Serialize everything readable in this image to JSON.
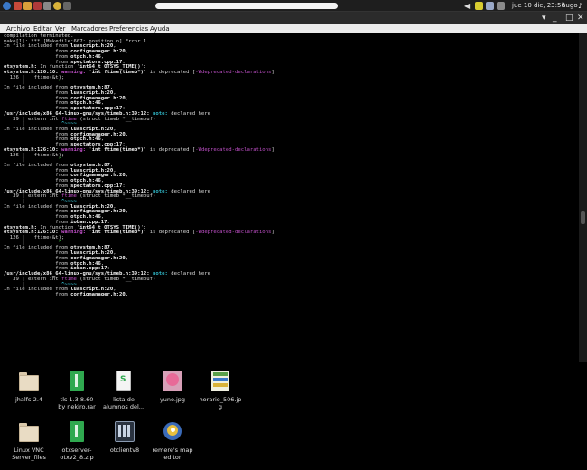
{
  "topbar": {
    "clock": "jue 10 dic, 23:56",
    "user": "hugo"
  },
  "window": {
    "controls": {
      "minimize": "_",
      "maximize": "□",
      "close": "✕",
      "menu": "▾"
    }
  },
  "menu": [
    "Archivo",
    "Editar",
    "Ver",
    "Marcadores",
    "Preferencias",
    "Ayuda"
  ],
  "terminal": {
    "lines": [
      [
        [
          "compilation terminated.",
          ""
        ]
      ],
      [
        [
          "make[1]: *** [Makefile:607: position.o] Error 1",
          ""
        ]
      ],
      [
        [
          "In file included from ",
          ""
        ],
        [
          "luascript.h:20",
          "b"
        ],
        [
          ",",
          ""
        ]
      ],
      [
        [
          "                 from ",
          ""
        ],
        [
          "configmanager.h:20",
          "b"
        ],
        [
          ",",
          ""
        ]
      ],
      [
        [
          "                 from ",
          ""
        ],
        [
          "otpch.h:46",
          "b"
        ],
        [
          ",",
          ""
        ]
      ],
      [
        [
          "                 from ",
          ""
        ],
        [
          "spectators.cpp:17",
          "b"
        ],
        [
          ":",
          ""
        ]
      ],
      [
        [
          "otsystem.h:",
          "b"
        ],
        [
          " In function '",
          ""
        ],
        [
          "int64_t OTSYS_TIME()",
          "b"
        ],
        [
          "':",
          ""
        ]
      ],
      [
        [
          "otsystem.h:126:10: ",
          "b"
        ],
        [
          "warning: ",
          "w"
        ],
        [
          "'",
          ""
        ],
        [
          "int ftime(timeb*)",
          "b"
        ],
        [
          "' is deprecated [",
          ""
        ],
        [
          "-Wdeprecated-declarations",
          "m"
        ],
        [
          "]",
          ""
        ]
      ],
      [
        [
          "  126 |   ftime(&t);",
          ""
        ]
      ],
      [
        [
          "      |           ",
          ""
        ],
        [
          "^",
          "g"
        ]
      ],
      [
        [
          "In file included from ",
          ""
        ],
        [
          "otsystem.h:87",
          "b"
        ],
        [
          ",",
          ""
        ]
      ],
      [
        [
          "                 from ",
          ""
        ],
        [
          "luascript.h:20",
          "b"
        ],
        [
          ",",
          ""
        ]
      ],
      [
        [
          "                 from ",
          ""
        ],
        [
          "configmanager.h:20",
          "b"
        ],
        [
          ",",
          ""
        ]
      ],
      [
        [
          "                 from ",
          ""
        ],
        [
          "otpch.h:46",
          "b"
        ],
        [
          ",",
          ""
        ]
      ],
      [
        [
          "                 from ",
          ""
        ],
        [
          "spectators.cpp:17",
          "b"
        ],
        [
          ":",
          ""
        ]
      ],
      [
        [
          "/usr/include/x86_64-linux-gnu/sys/timeb.h:39:12: ",
          "b"
        ],
        [
          "note: ",
          "n"
        ],
        [
          "declared here",
          ""
        ]
      ],
      [
        [
          "   39 | extern int ",
          ""
        ],
        [
          "ftime",
          "m"
        ],
        [
          " (struct timeb *__timebuf)",
          ""
        ]
      ],
      [
        [
          "      |            ",
          ""
        ],
        [
          "^~~~~",
          "n"
        ]
      ],
      [
        [
          "In file included from ",
          ""
        ],
        [
          "luascript.h:20",
          "b"
        ],
        [
          ",",
          ""
        ]
      ],
      [
        [
          "                 from ",
          ""
        ],
        [
          "configmanager.h:20",
          "b"
        ],
        [
          ",",
          ""
        ]
      ],
      [
        [
          "                 from ",
          ""
        ],
        [
          "otpch.h:46",
          "b"
        ],
        [
          ",",
          ""
        ]
      ],
      [
        [
          "                 from ",
          ""
        ],
        [
          "spectators.cpp:17",
          "b"
        ],
        [
          ":",
          ""
        ]
      ],
      [
        [
          "otsystem.h:126:10: ",
          "b"
        ],
        [
          "warning: ",
          "w"
        ],
        [
          "'",
          ""
        ],
        [
          "int ftime(timeb*)",
          "b"
        ],
        [
          "' is deprecated [",
          ""
        ],
        [
          "-Wdeprecated-declarations",
          "m"
        ],
        [
          "]",
          ""
        ]
      ],
      [
        [
          "  126 |   ftime(&t);",
          ""
        ]
      ],
      [
        [
          "      |           ",
          ""
        ],
        [
          "^",
          "g"
        ]
      ],
      [
        [
          "In file included from ",
          ""
        ],
        [
          "otsystem.h:87",
          "b"
        ],
        [
          ",",
          ""
        ]
      ],
      [
        [
          "                 from ",
          ""
        ],
        [
          "luascript.h:20",
          "b"
        ],
        [
          ",",
          ""
        ]
      ],
      [
        [
          "                 from ",
          ""
        ],
        [
          "configmanager.h:20",
          "b"
        ],
        [
          ",",
          ""
        ]
      ],
      [
        [
          "                 from ",
          ""
        ],
        [
          "otpch.h:46",
          "b"
        ],
        [
          ",",
          ""
        ]
      ],
      [
        [
          "                 from ",
          ""
        ],
        [
          "spectators.cpp:17",
          "b"
        ],
        [
          ":",
          ""
        ]
      ],
      [
        [
          "/usr/include/x86_64-linux-gnu/sys/timeb.h:39:12: ",
          "b"
        ],
        [
          "note: ",
          "n"
        ],
        [
          "declared here",
          ""
        ]
      ],
      [
        [
          "   39 | extern int ",
          ""
        ],
        [
          "ftime",
          "m"
        ],
        [
          " (struct timeb *__timebuf)",
          ""
        ]
      ],
      [
        [
          "      |            ",
          ""
        ],
        [
          "^~~~~",
          "n"
        ]
      ],
      [
        [
          "In file included from ",
          ""
        ],
        [
          "luascript.h:20",
          "b"
        ],
        [
          ",",
          ""
        ]
      ],
      [
        [
          "                 from ",
          ""
        ],
        [
          "configmanager.h:20",
          "b"
        ],
        [
          ",",
          ""
        ]
      ],
      [
        [
          "                 from ",
          ""
        ],
        [
          "otpch.h:46",
          "b"
        ],
        [
          ",",
          ""
        ]
      ],
      [
        [
          "                 from ",
          ""
        ],
        [
          "ioban.cpp:17",
          "b"
        ],
        [
          ":",
          ""
        ]
      ],
      [
        [
          "otsystem.h:",
          "b"
        ],
        [
          " In function '",
          ""
        ],
        [
          "int64_t OTSYS_TIME()",
          "b"
        ],
        [
          "':",
          ""
        ]
      ],
      [
        [
          "otsystem.h:126:10: ",
          "b"
        ],
        [
          "warning: ",
          "w"
        ],
        [
          "'",
          ""
        ],
        [
          "int ftime(timeb*)",
          "b"
        ],
        [
          "' is deprecated [",
          ""
        ],
        [
          "-Wdeprecated-declarations",
          "m"
        ],
        [
          "]",
          ""
        ]
      ],
      [
        [
          "  126 |   ftime(&t);",
          ""
        ]
      ],
      [
        [
          "      |           ",
          ""
        ],
        [
          "^",
          "g"
        ]
      ],
      [
        [
          "In file included from ",
          ""
        ],
        [
          "otsystem.h:87",
          "b"
        ],
        [
          ",",
          ""
        ]
      ],
      [
        [
          "                 from ",
          ""
        ],
        [
          "luascript.h:20",
          "b"
        ],
        [
          ",",
          ""
        ]
      ],
      [
        [
          "                 from ",
          ""
        ],
        [
          "configmanager.h:20",
          "b"
        ],
        [
          ",",
          ""
        ]
      ],
      [
        [
          "                 from ",
          ""
        ],
        [
          "otpch.h:46",
          "b"
        ],
        [
          ",",
          ""
        ]
      ],
      [
        [
          "                 from ",
          ""
        ],
        [
          "ioban.cpp:17",
          "b"
        ],
        [
          ":",
          ""
        ]
      ],
      [
        [
          "/usr/include/x86_64-linux-gnu/sys/timeb.h:39:12: ",
          "b"
        ],
        [
          "note: ",
          "n"
        ],
        [
          "declared here",
          ""
        ]
      ],
      [
        [
          "   39 | extern int ",
          ""
        ],
        [
          "ftime",
          "m"
        ],
        [
          " (struct timeb *__timebuf)",
          ""
        ]
      ],
      [
        [
          "      |            ",
          ""
        ],
        [
          "^~~~~",
          "n"
        ]
      ],
      [
        [
          "In file included from ",
          ""
        ],
        [
          "luascript.h:20",
          "b"
        ],
        [
          ",",
          ""
        ]
      ],
      [
        [
          "                 from ",
          ""
        ],
        [
          "configmanager.h:20",
          "b"
        ],
        [
          ",",
          ""
        ]
      ]
    ]
  },
  "desktop": {
    "icons": [
      {
        "label": "jhalfs-2.4",
        "kind": "folder"
      },
      {
        "label": "tls 1.3 8.60\nby nekiro.rar",
        "kind": "archive"
      },
      {
        "label": "lista de\nalumnos del...",
        "kind": "spreadsheet"
      },
      {
        "label": "yuno.jpg",
        "kind": "image-pink"
      },
      {
        "label": "horario_506.jp\ng",
        "kind": "image-grid"
      },
      {
        "label": "Linux VNC\nServer_files",
        "kind": "folder"
      },
      {
        "label": "otxserver-\notxv2_8.zip",
        "kind": "archive"
      },
      {
        "label": "otclientv8",
        "kind": "app-otc"
      },
      {
        "label": "remere's map\neditor",
        "kind": "app-rme"
      }
    ]
  },
  "colors": {
    "warning": "#c050c8",
    "note": "#30b8c8",
    "caret": "#43c043",
    "archive_icon": "#2fa84f"
  }
}
